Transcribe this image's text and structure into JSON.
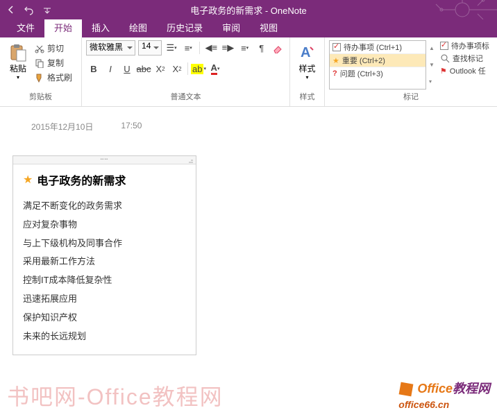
{
  "window": {
    "title": "电子政务的新需求 - OneNote"
  },
  "tabs": [
    "文件",
    "开始",
    "插入",
    "绘图",
    "历史记录",
    "审阅",
    "视图"
  ],
  "active_tab": 1,
  "ribbon": {
    "clipboard": {
      "paste": "粘贴",
      "cut": "剪切",
      "copy": "复制",
      "format_painter": "格式刷",
      "label": "剪贴板"
    },
    "font": {
      "name": "微软雅黑",
      "size": "14",
      "label": "普通文本"
    },
    "styles": {
      "btn": "样式",
      "label": "样式"
    },
    "tags": {
      "items": [
        {
          "label": "待办事项 (Ctrl+1)",
          "icon": "checkbox"
        },
        {
          "label": "重要 (Ctrl+2)",
          "icon": "star"
        },
        {
          "label": "问题 (Ctrl+3)",
          "icon": "question"
        }
      ],
      "todo_tag": "待办事项标",
      "find_tags": "查找标记",
      "outlook": "Outlook 任",
      "label": "标记"
    }
  },
  "page": {
    "date": "2015年12月10日",
    "time": "17:50",
    "title": "电子政务的新需求",
    "lines": [
      "满足不断变化的政务需求",
      "应对复杂事物",
      "与上下级机构及同事合作",
      "采用最新工作方法",
      "控制IT成本降低复杂性",
      "迅速拓展应用",
      "保护知识产权",
      "未来的长远规划"
    ]
  },
  "watermark": {
    "left": "书吧网-Office教程网",
    "right_brand": "Office",
    "right_suffix": "教程网",
    "right_url": "office66.cn"
  }
}
